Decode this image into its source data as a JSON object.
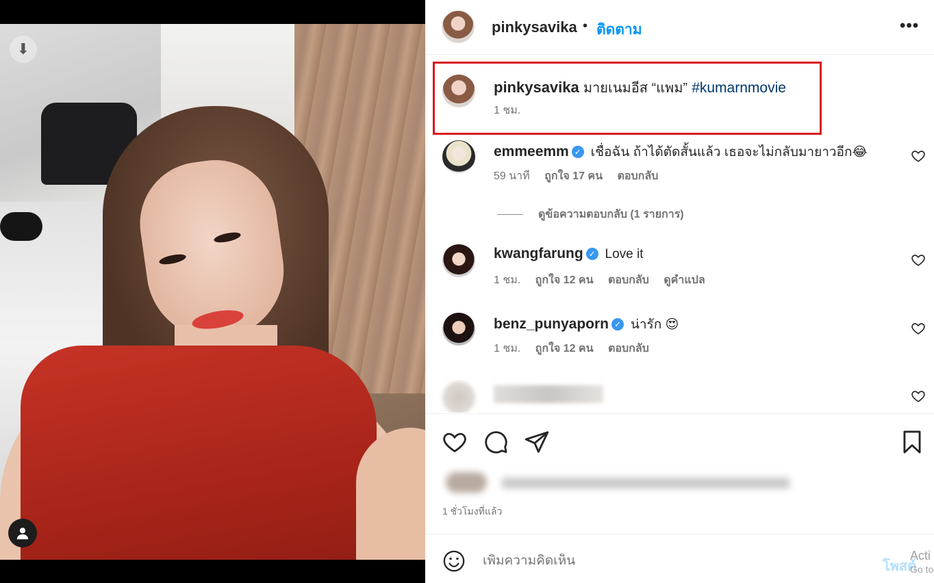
{
  "post": {
    "username": "pinkysavika",
    "dot": "•",
    "follow_label": "ติดตาม",
    "more_icon": "more-horizontal-icon",
    "caption": {
      "text": "มายเนมอีส “แพม”",
      "hashtag": "#kumarnmovie",
      "time": "1 ชม."
    }
  },
  "comments": [
    {
      "username": "emmeemm",
      "verified": true,
      "text": "เชื่อฉัน ถ้าได้ตัดสั้นแล้ว เธอจะไม่กลับมายาวอีก😂",
      "time": "59 นาที",
      "likes": "ถูกใจ 17 คน",
      "reply": "ตอบกลับ",
      "view_replies": "ดูข้อความตอบกลับ (1 รายการ)"
    },
    {
      "username": "kwangfarung",
      "verified": true,
      "text": "Love it",
      "time": "1 ชม.",
      "likes": "ถูกใจ 12 คน",
      "reply": "ตอบกลับ",
      "translate": "ดูคำแปล"
    },
    {
      "username": "benz_punyaporn",
      "verified": true,
      "text": "น่ารัก 😍",
      "time": "1 ชม.",
      "likes": "ถูกใจ 12 คน",
      "reply": "ตอบกลับ"
    }
  ],
  "actions": {
    "like_icon": "heart-icon",
    "comment_icon": "comment-icon",
    "share_icon": "send-icon",
    "save_icon": "bookmark-icon"
  },
  "post_time": "1 ชั่วโมงที่แล้ว",
  "add_comment": {
    "placeholder": "เพิ่มความคิดเห็น",
    "post_label": "โพสต์"
  },
  "watermark": {
    "line1": "Acti",
    "line2": "Go to"
  },
  "colors": {
    "accent": "#0095f6",
    "hashtag": "#00376b",
    "highlight_border": "#d8141b",
    "verified": "#3897f0"
  }
}
